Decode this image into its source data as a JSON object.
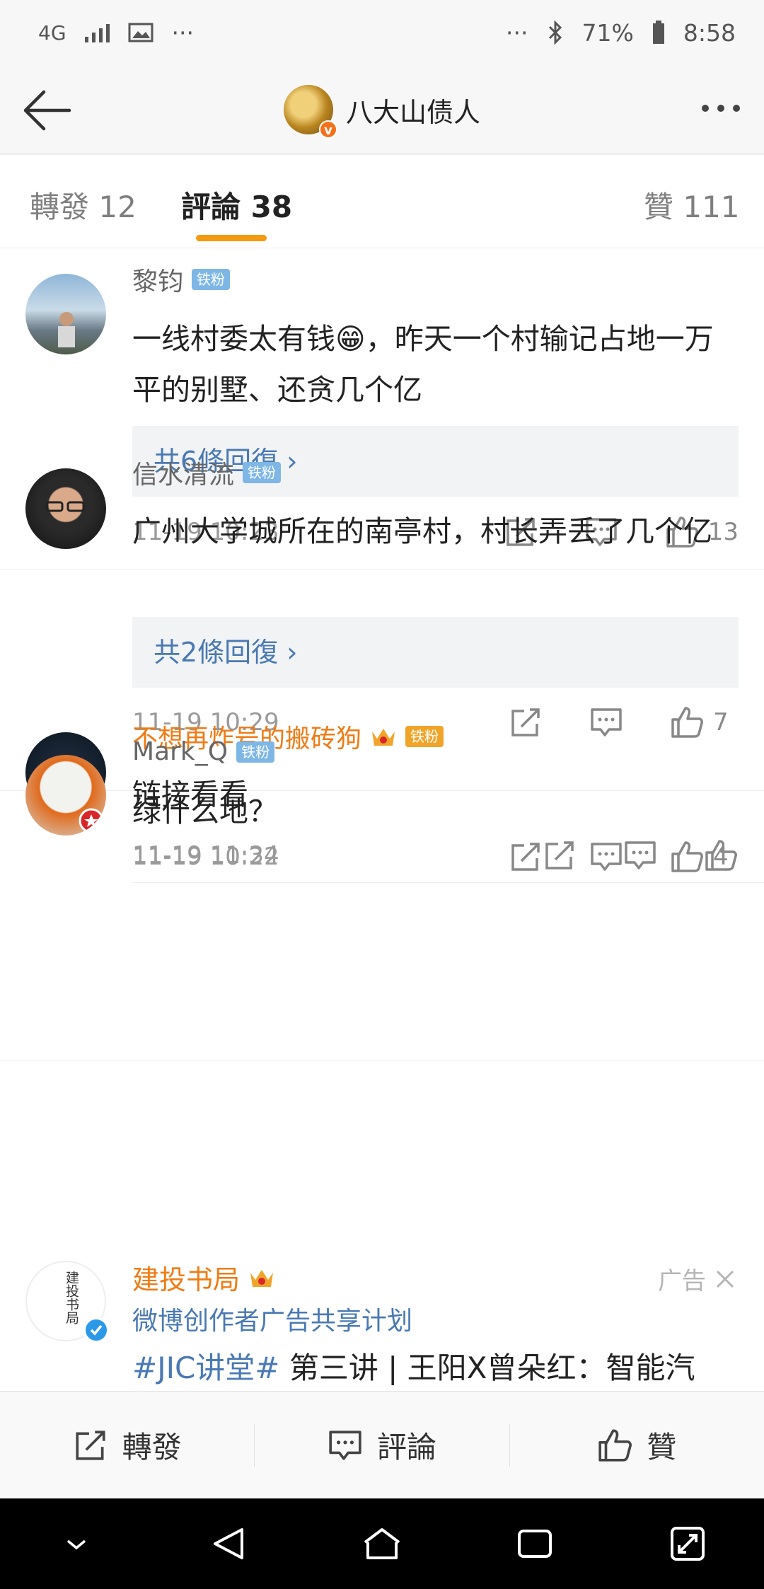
{
  "status_bar": {
    "network": "4G",
    "battery": "71%",
    "time": "8:58",
    "dots": "···"
  },
  "header": {
    "title": "八大山债人",
    "verified_mark": "v"
  },
  "tabs": [
    {
      "label": "轉發 12"
    },
    {
      "label": "評論 38"
    },
    {
      "label": "贊 111"
    }
  ],
  "comments": [
    {
      "user": "黎钧",
      "badge": "铁粉",
      "text": "一线村委太有钱😁，昨天一个村输记占地一万平的别墅、还贪几个亿",
      "replies": "共6條回復 ›",
      "time": "11-19 10:23",
      "likes": "13"
    },
    {
      "user": "信水清流",
      "badge": "铁粉",
      "text": "广州大学城所在的南亭村，村长弄丢了几个亿",
      "replies": "共2條回復 ›",
      "time": "11-19 10:29",
      "likes": "7"
    },
    {
      "user": "不想再炸号的搬砖狗",
      "badge": "铁粉",
      "text": "链接看看",
      "time": "11-19 11:34",
      "likes": ""
    },
    {
      "user": "Mark_Q",
      "badge": "铁粉",
      "text": "绿什么地？",
      "time": "11-19 10:22",
      "likes": "4"
    }
  ],
  "ad": {
    "name": "建投书局",
    "tag": "广告",
    "subtitle": "微博创作者广告共享计划",
    "hashtag": "#JIC讲堂#",
    "text": " 第三讲 | 王阳X曾朵红：智能汽",
    "avatar_text": "建投书局"
  },
  "bottom_bar": {
    "repost": "轉發",
    "comment": "評論",
    "like": "贊"
  },
  "icons": {
    "back": "arrow-left-icon",
    "more": "more-dots-icon",
    "repost": "repost-icon",
    "comment": "comment-icon",
    "like": "thumbs-up-icon",
    "close": "close-icon",
    "crown": "crown-icon",
    "bluetooth": "bluetooth-icon",
    "wifi": "signal-icon"
  },
  "colors": {
    "accent": "#f49a10",
    "link": "#4a79b3",
    "username_vip": "#f07b14",
    "badge": "#7eb6e6"
  }
}
